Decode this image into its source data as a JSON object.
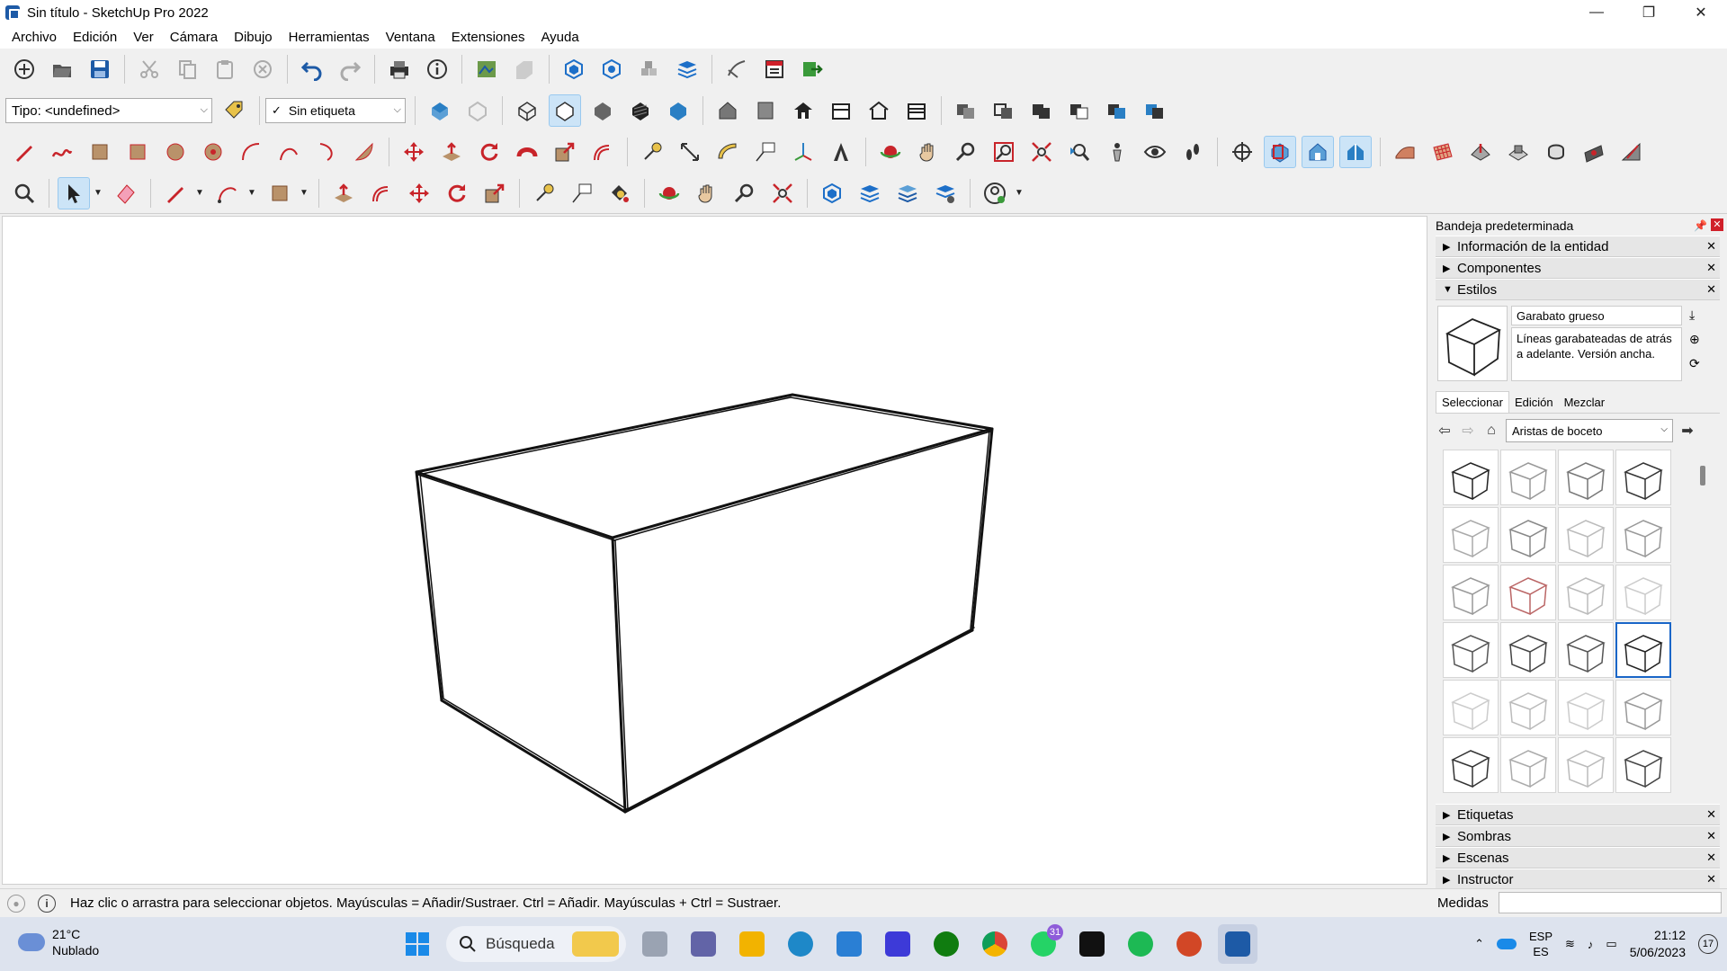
{
  "window": {
    "title": "Sin título - SketchUp Pro 2022",
    "minimize": "—",
    "maximize": "❐",
    "close": "✕"
  },
  "menu": [
    "Archivo",
    "Edición",
    "Ver",
    "Cámara",
    "Dibujo",
    "Herramientas",
    "Ventana",
    "Extensiones",
    "Ayuda"
  ],
  "toolbar2": {
    "type_select": "Tipo: <undefined>",
    "tag_select": "Sin etiqueta",
    "tag_check": "✓"
  },
  "tray": {
    "title": "Bandeja predeterminada",
    "panels_top": [
      {
        "label": "Información de la entidad",
        "expanded": false
      },
      {
        "label": "Componentes",
        "expanded": false
      },
      {
        "label": "Estilos",
        "expanded": true
      }
    ],
    "style": {
      "name": "Garabato grueso",
      "description": "Líneas garabateadas de atrás a adelante.  Versión ancha."
    },
    "tabs": [
      "Seleccionar",
      "Edición",
      "Mezclar"
    ],
    "library": "Aristas de boceto",
    "panels_bottom": [
      "Etiquetas",
      "Sombras",
      "Escenas",
      "Instructor"
    ]
  },
  "status": {
    "message": "Haz clic o arrastra para seleccionar objetos. Mayúsculas = Añadir/Sustraer. Ctrl = Añadir. Mayúsculas + Ctrl = Sustraer.",
    "measures_label": "Medidas"
  },
  "taskbar": {
    "temperature": "21°C",
    "weather": "Nublado",
    "search": "Búsqueda",
    "whatsapp_badge": "31",
    "lang1": "ESP",
    "lang2": "ES",
    "time": "21:12",
    "date": "5/06/2023",
    "notifications": "17"
  }
}
